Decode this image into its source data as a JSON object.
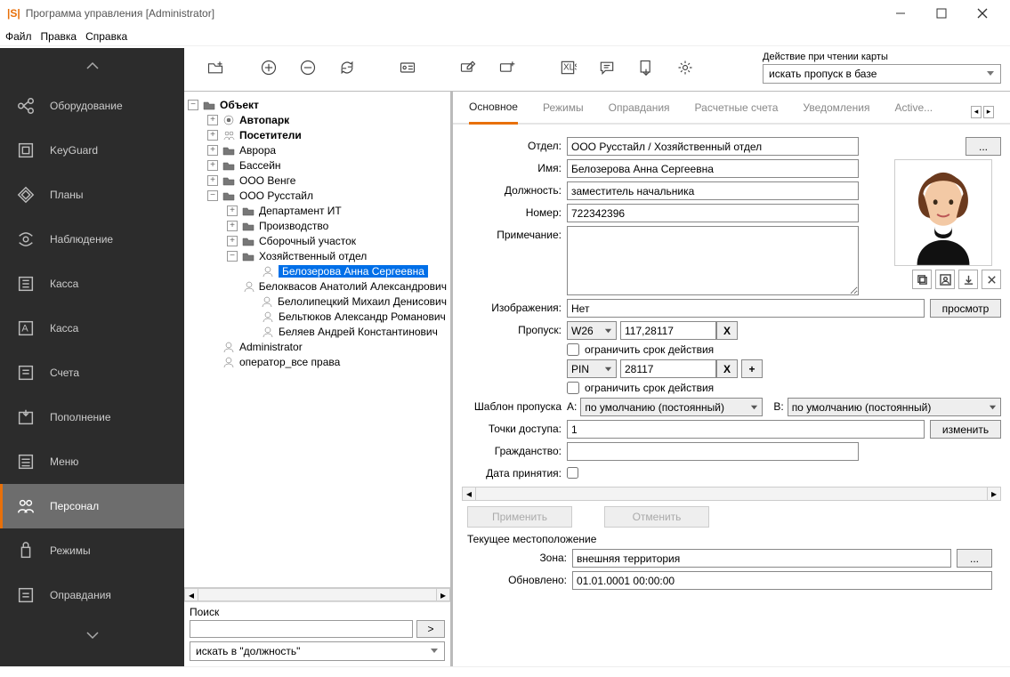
{
  "window": {
    "title": "Программа управления [Administrator]"
  },
  "menu": {
    "file": "Файл",
    "edit": "Правка",
    "help": "Справка"
  },
  "sidenav": {
    "items": [
      {
        "label": "Оборудование"
      },
      {
        "label": "KeyGuard"
      },
      {
        "label": "Планы"
      },
      {
        "label": "Наблюдение"
      },
      {
        "label": "Касса"
      },
      {
        "label": "Касса"
      },
      {
        "label": "Счета"
      },
      {
        "label": "Пополнение"
      },
      {
        "label": "Меню"
      },
      {
        "label": "Персонал"
      },
      {
        "label": "Режимы"
      },
      {
        "label": "Оправдания"
      }
    ]
  },
  "card_action": {
    "label": "Действие при чтении карты",
    "value": "искать пропуск в базе"
  },
  "tree": {
    "root": "Объект",
    "n_autopark": "Автопарк",
    "n_visitors": "Посетители",
    "n_aurora": "Аврора",
    "n_pool": "Бассейн",
    "n_venge": "ООО Венге",
    "n_russtyle": "ООО Русстайл",
    "n_it": "Департамент ИТ",
    "n_prod": "Производство",
    "n_asm": "Сборочный участок",
    "n_house": "Хозяйственный отдел",
    "p_belozerova": "Белозерова Анна Сергеевна",
    "p_belokvasov": "Белоквасов Анатолий Александрович",
    "p_belolip": "Белолипецкий Михаил Денисович",
    "p_beltyukov": "Бельтюков Александр Романович",
    "p_belyaev": "Беляев Андрей Константинович",
    "u_admin": "Administrator",
    "u_oper": "оператор_все права"
  },
  "search": {
    "label": "Поиск",
    "go": ">",
    "field_value": "искать в \"должность\""
  },
  "tabs": {
    "main": "Основное",
    "modes": "Режимы",
    "excuses": "Оправдания",
    "accounts": "Расчетные счета",
    "notifications": "Уведомления",
    "active": "Active..."
  },
  "form": {
    "dept_label": "Отдел:",
    "dept_value": "ООО Русстайл / Хозяйственный отдел",
    "dept_more": "...",
    "name_label": "Имя:",
    "name_value": "Белозерова Анна Сергеевна",
    "pos_label": "Должность:",
    "pos_value": "заместитель начальника",
    "num_label": "Номер:",
    "num_value": "722342396",
    "note_label": "Примечание:",
    "img_label": "Изображения:",
    "img_value": "Нет",
    "img_view": "просмотр",
    "pass_label": "Пропуск:",
    "pass_format": "W26",
    "pass_value": "117,28117",
    "limit_label": "ограничить срок действия",
    "pin_label": "PIN",
    "pin_value": "28117",
    "tmpl_label": "Шаблон пропуска",
    "tmpl_a": "A:",
    "tmpl_b": "B:",
    "tmpl_default": "по умолчанию (постоянный)",
    "ap_label": "Точки доступа:",
    "ap_value": "1",
    "ap_change": "изменить",
    "citizen_label": "Гражданство:",
    "hire_label": "Дата принятия:",
    "apply": "Применить",
    "cancel": "Отменить"
  },
  "location": {
    "head": "Текущее местоположение",
    "zone_label": "Зона:",
    "zone_value": "внешняя территория",
    "zone_more": "...",
    "updated_label": "Обновлено:",
    "updated_value": "01.01.0001 00:00:00"
  }
}
